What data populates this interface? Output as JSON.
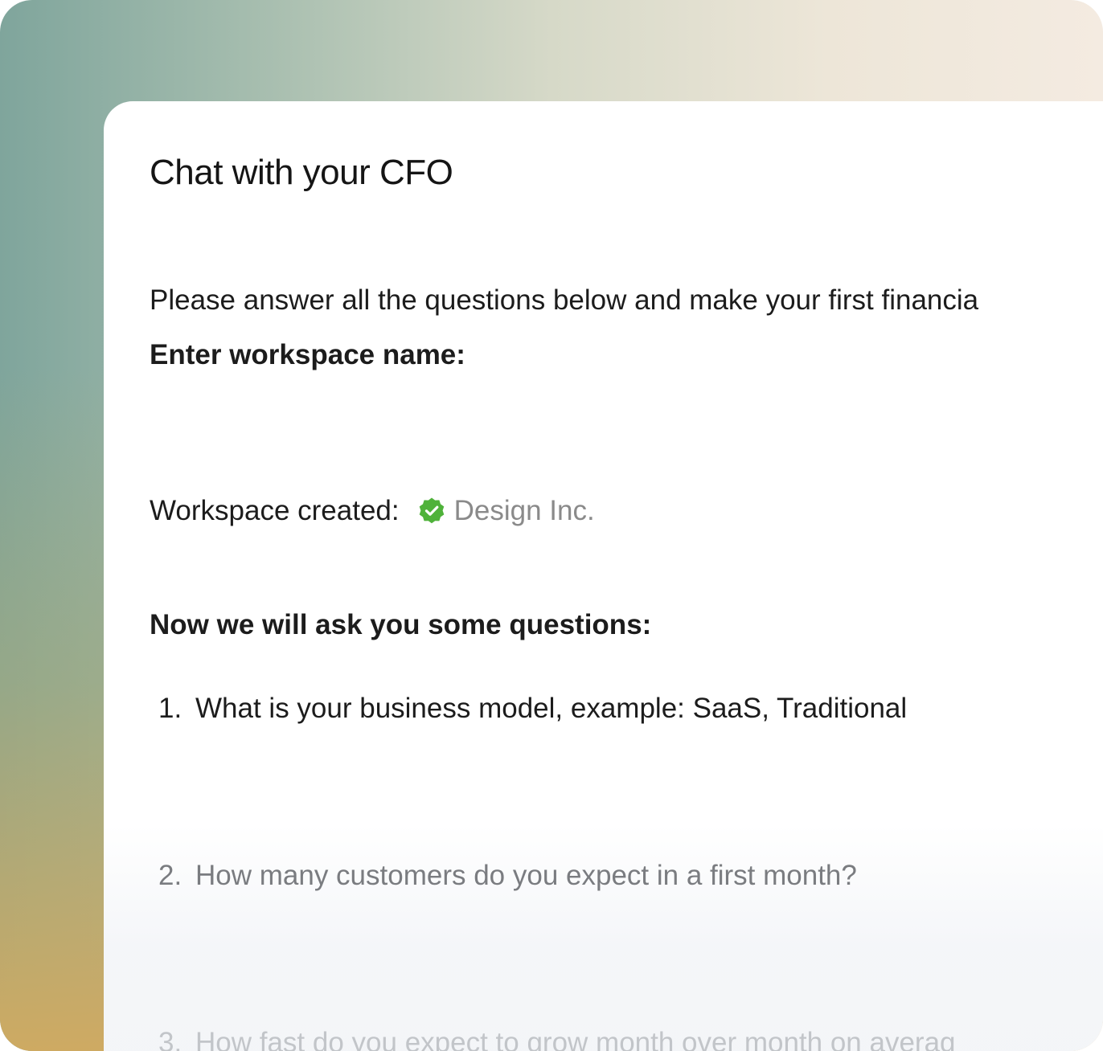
{
  "chat": {
    "title": "Chat with your CFO",
    "intro": "Please answer all the questions below and make your first financia",
    "prompt": "Enter workspace name:",
    "workspace_label": "Workspace created:",
    "workspace_name": "Design Inc.",
    "questions_heading": "Now we will ask you some questions:",
    "questions": [
      {
        "number": "1.",
        "text": "What is your business model, example: SaaS, Traditional"
      },
      {
        "number": "2.",
        "text": "How many customers do you expect in a first month?"
      },
      {
        "number": "3.",
        "text": "How fast do you expect to grow month over month on averag"
      }
    ]
  },
  "colors": {
    "verified_badge": "#4fb23a",
    "muted_text": "#8a8a8a"
  },
  "icons": {
    "workspace_badge": "verified-check-icon"
  }
}
